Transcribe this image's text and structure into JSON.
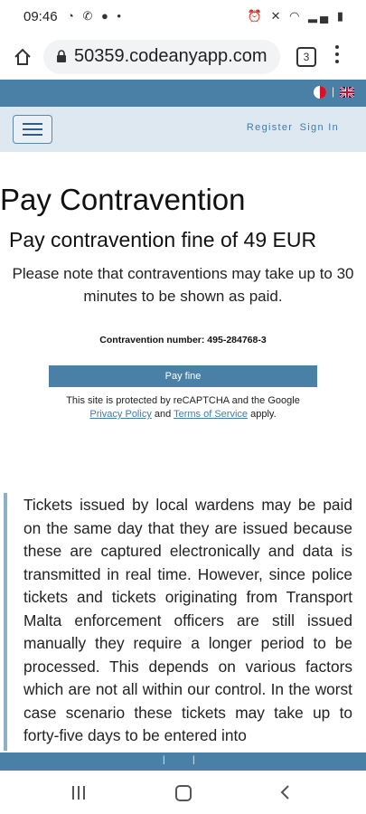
{
  "status_bar": {
    "time": "09:46",
    "left_icons": "◔ ✆ ● •",
    "right_icons": "⏰ ✕ ◠ ▂▄ ▮"
  },
  "browser": {
    "url": "50359.codeanyapp.com",
    "tab_count": "3"
  },
  "language_bar": {
    "separator": "|",
    "languages": [
      "maltese-flag",
      "english-flag"
    ]
  },
  "nav": {
    "register_label": "Register",
    "signin_label": "Sign In"
  },
  "main": {
    "title": "Pay Contravention",
    "subtitle": "Pay contravention fine of 49 EUR",
    "note": "Please note that contraventions may take up to 30 minutes to be shown as paid.",
    "contravention_label": "Contravention number: 495-284768-3",
    "pay_button": "Pay fine",
    "recaptcha_prefix": "This site is protected by reCAPTCHA and the Google",
    "privacy_link": "Privacy Policy",
    "and_text": "and",
    "terms_link": "Terms of Service",
    "apply_text": "apply."
  },
  "info": {
    "paragraph": "Tickets issued by local wardens may be paid on the same day that they are issued because these are captured electronically and data is transmitted in real time. However, since police tickets and tickets originating from Transport Malta enforcement officers are still issued manually they require a longer period to be processed. This depends on various factors which are not all within our control. In the worst case scenario these tickets may take up to forty-five days to be entered into"
  },
  "footer": {
    "separator": "|"
  },
  "colors": {
    "brand_blue": "#4a7fa6",
    "nav_bg": "#dde8f0",
    "link_blue": "#3f7bb0"
  }
}
